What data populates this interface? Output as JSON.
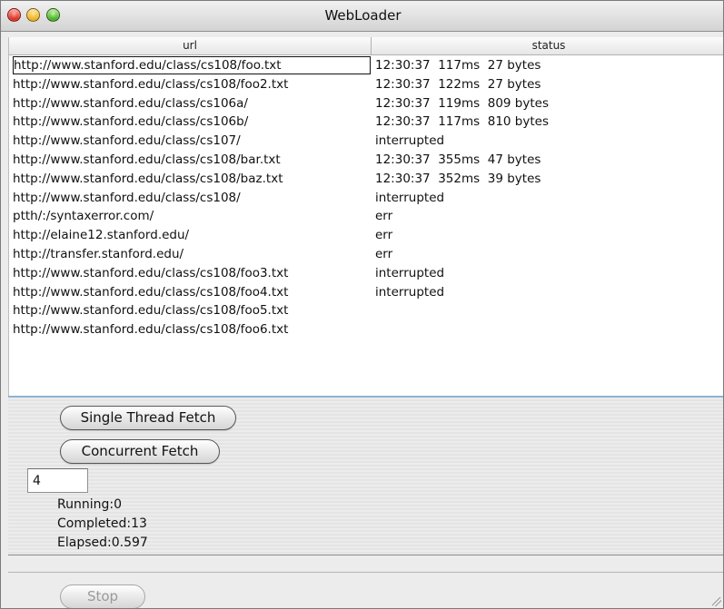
{
  "window": {
    "title": "WebLoader"
  },
  "table": {
    "columns": [
      "url",
      "status"
    ],
    "rows": [
      {
        "url": "http://www.stanford.edu/class/cs108/foo.txt",
        "status": "12:30:37  117ms  27 bytes"
      },
      {
        "url": "http://www.stanford.edu/class/cs108/foo2.txt",
        "status": "12:30:37  122ms  27 bytes"
      },
      {
        "url": "http://www.stanford.edu/class/cs106a/",
        "status": "12:30:37  119ms  809 bytes"
      },
      {
        "url": "http://www.stanford.edu/class/cs106b/",
        "status": "12:30:37  117ms  810 bytes"
      },
      {
        "url": "http://www.stanford.edu/class/cs107/",
        "status": "interrupted"
      },
      {
        "url": "http://www.stanford.edu/class/cs108/bar.txt",
        "status": "12:30:37  355ms  47 bytes"
      },
      {
        "url": "http://www.stanford.edu/class/cs108/baz.txt",
        "status": "12:30:37  352ms  39 bytes"
      },
      {
        "url": "http://www.stanford.edu/class/cs108/",
        "status": "interrupted"
      },
      {
        "url": "ptth/:/syntaxerror.com/",
        "status": "err"
      },
      {
        "url": "http://elaine12.stanford.edu/",
        "status": "err"
      },
      {
        "url": "http://transfer.stanford.edu/",
        "status": "err"
      },
      {
        "url": "http://www.stanford.edu/class/cs108/foo3.txt",
        "status": "interrupted"
      },
      {
        "url": "http://www.stanford.edu/class/cs108/foo4.txt",
        "status": "interrupted"
      },
      {
        "url": "http://www.stanford.edu/class/cs108/foo5.txt",
        "status": ""
      },
      {
        "url": "http://www.stanford.edu/class/cs108/foo6.txt",
        "status": ""
      }
    ],
    "selected_row": 0
  },
  "controls": {
    "single_thread_label": "Single Thread Fetch",
    "concurrent_label": "Concurrent Fetch",
    "thread_count": "4",
    "running": "Running:0",
    "completed": "Completed:13",
    "elapsed": "Elapsed:0.597",
    "stop_label": "Stop"
  },
  "colors": {
    "selection_border": "#111111",
    "divider_accent": "#8fb1d4"
  }
}
